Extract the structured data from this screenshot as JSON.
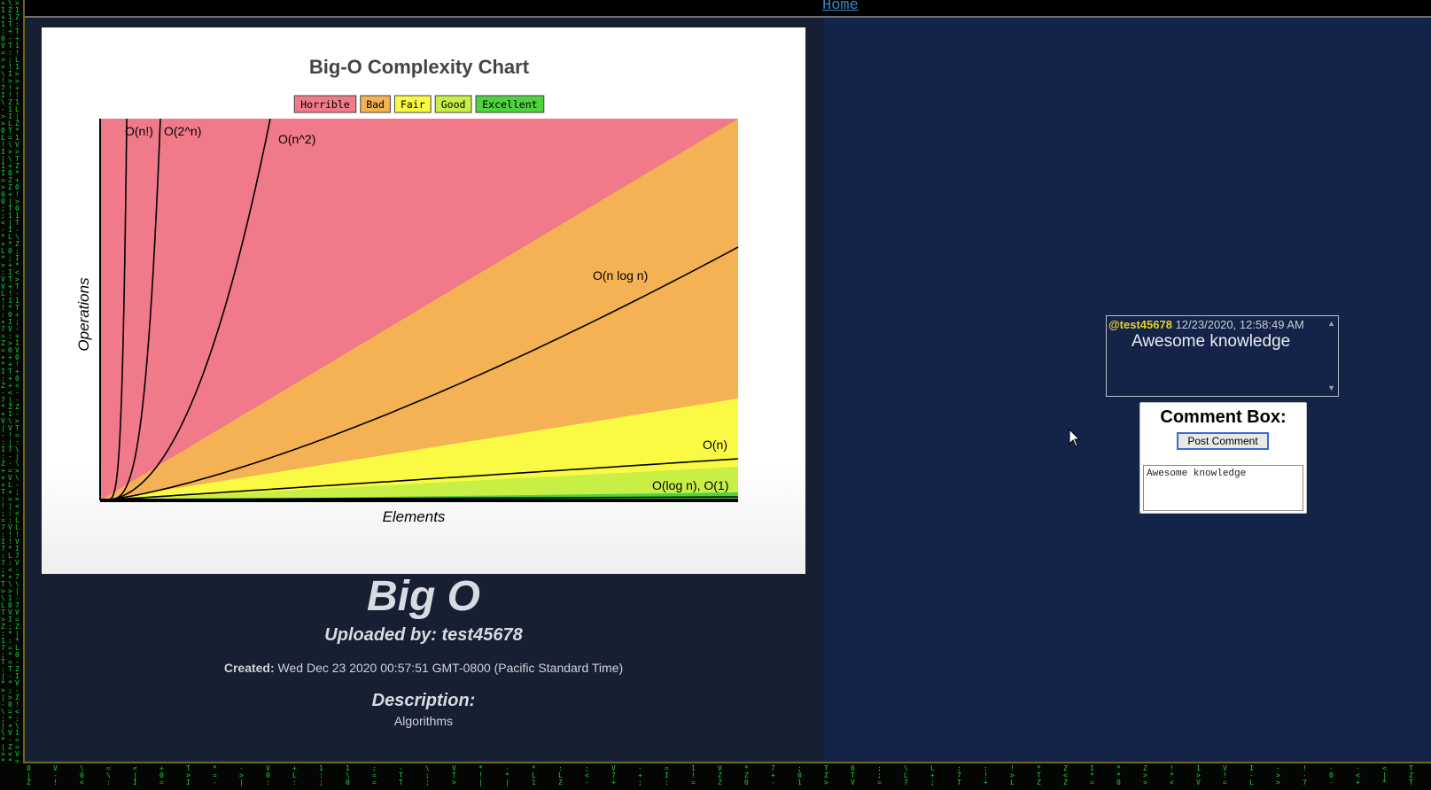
{
  "nav": {
    "home_label": "Home"
  },
  "post": {
    "title": "Big O",
    "uploaded_by": "Uploaded by: test45678",
    "created_label": "Created:",
    "created_value": "Wed Dec 23 2020 00:57:51 GMT-0800 (Pacific Standard Time)",
    "description_label": "Description:",
    "description_value": "Algorithms"
  },
  "chart": {
    "title": "Big-O Complexity Chart",
    "legend": [
      {
        "label": "Horrible",
        "color": "#f07a8a"
      },
      {
        "label": "Bad",
        "color": "#f5b254"
      },
      {
        "label": "Fair",
        "color": "#fafa45"
      },
      {
        "label": "Good",
        "color": "#c8ef45"
      },
      {
        "label": "Excellent",
        "color": "#4ed23f"
      }
    ],
    "xlabel": "Elements",
    "ylabel": "Operations",
    "curve_labels": {
      "factorial": "O(n!)",
      "exponential": "O(2^n)",
      "quadratic": "O(n^2)",
      "nlogn": "O(n log n)",
      "linear": "O(n)",
      "log_const": "O(log n), O(1)"
    }
  },
  "comments": [
    {
      "user": "@test45678",
      "timestamp": "12/23/2020, 12:58:49 AM",
      "text": "Awesome knowledge"
    }
  ],
  "comment_box": {
    "title": "Comment Box:",
    "post_button": "Post Comment",
    "input_value": "Awesome knowledge"
  },
  "colors": {
    "background": "#142448",
    "panel": "#171f33",
    "username": "#e8d02a",
    "link": "#3a88c8"
  }
}
